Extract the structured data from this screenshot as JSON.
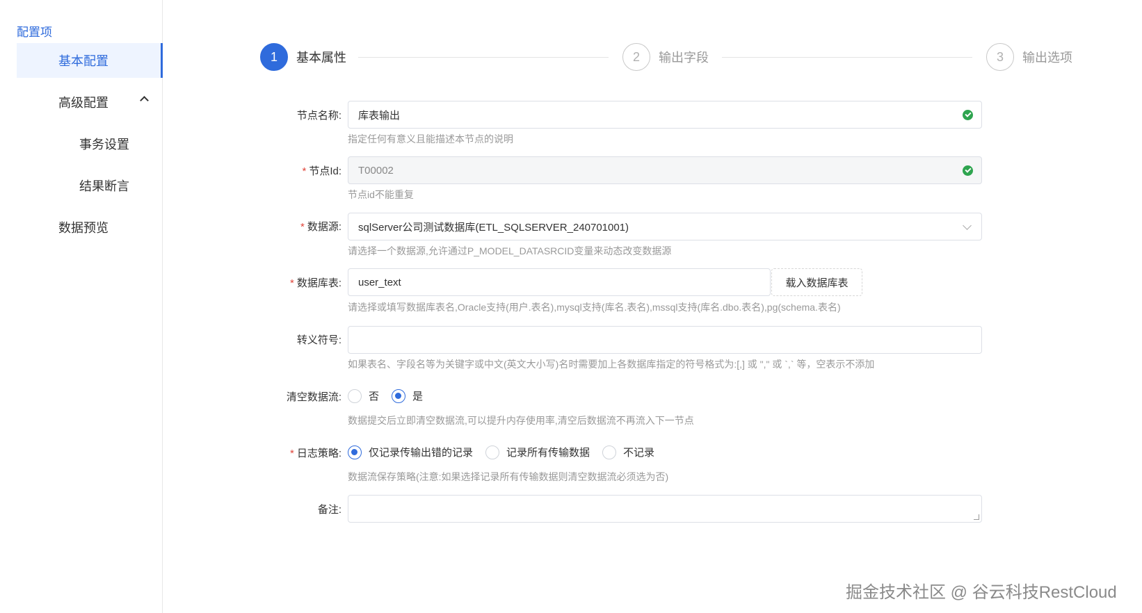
{
  "sidebar": {
    "title": "配置项",
    "items": [
      {
        "label": "基本配置"
      },
      {
        "label": "高级配置"
      },
      {
        "label": "事务设置"
      },
      {
        "label": "结果断言"
      },
      {
        "label": "数据预览"
      }
    ]
  },
  "steps": [
    {
      "num": "1",
      "label": "基本属性"
    },
    {
      "num": "2",
      "label": "输出字段"
    },
    {
      "num": "3",
      "label": "输出选项"
    }
  ],
  "form": {
    "node_name": {
      "label": "节点名称:",
      "value": "库表输出",
      "hint": "指定任何有意义且能描述本节点的说明"
    },
    "node_id": {
      "label": "节点Id:",
      "value": "T00002",
      "hint": "节点id不能重复"
    },
    "datasource": {
      "label": "数据源:",
      "value": "sqlServer公司测试数据库(ETL_SQLSERVER_240701001)",
      "hint": "请选择一个数据源,允许通过P_MODEL_DATASRCID变量来动态改变数据源"
    },
    "db_table": {
      "label": "数据库表:",
      "value": "user_text",
      "button": "载入数据库表",
      "hint": "请选择或填写数据库表名,Oracle支持(用户.表名),mysql支持(库名.表名),mssql支持(库名.dbo.表名),pg(schema.表名)"
    },
    "escape": {
      "label": "转义符号:",
      "value": "",
      "hint": "如果表名、字段名等为关键字或中文(英文大小写)名时需要加上各数据库指定的符号格式为:[,] 或 \",\" 或 `,` 等，空表示不添加"
    },
    "clear_stream": {
      "label": "清空数据流:",
      "options": [
        "否",
        "是"
      ],
      "selected": "是",
      "hint": "数据提交后立即清空数据流,可以提升内存使用率,清空后数据流不再流入下一节点"
    },
    "log_strategy": {
      "label": "日志策略:",
      "options": [
        "仅记录传输出错的记录",
        "记录所有传输数据",
        "不记录"
      ],
      "selected": "仅记录传输出错的记录",
      "hint": "数据流保存策略(注意:如果选择记录所有传输数据则清空数据流必须选为否)"
    },
    "remark": {
      "label": "备注:",
      "value": ""
    }
  },
  "required_mark": "*",
  "watermark": "掘金技术社区 @ 谷云科技RestCloud",
  "colors": {
    "accent": "#2f6bdc",
    "success": "#2ea44f",
    "required": "#e0463b"
  }
}
